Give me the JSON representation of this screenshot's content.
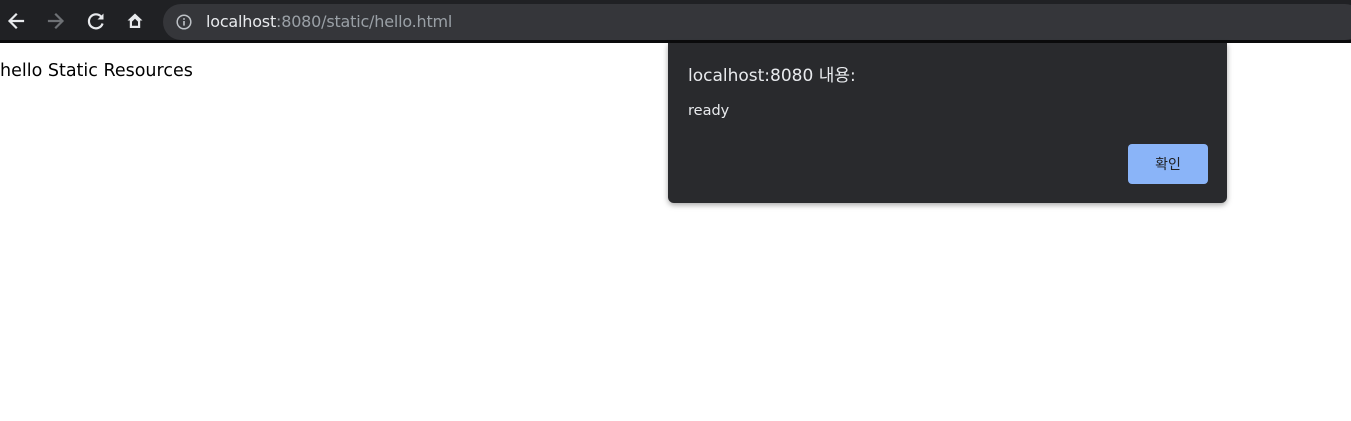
{
  "browser": {
    "back_icon": "arrow-left-icon",
    "forward_icon": "arrow-right-icon",
    "reload_icon": "reload-icon",
    "home_icon": "home-icon",
    "site_info_icon": "info-icon",
    "address": {
      "host": "localhost",
      "rest": ":8080/static/hello.html"
    },
    "colors": {
      "toolbar": "#202124",
      "omnibox": "#35363a",
      "icon_active": "#e8eaed",
      "icon_disabled": "#6e7175"
    }
  },
  "page": {
    "text": "hello Static Resources"
  },
  "alert_dialog": {
    "title": "localhost:8080 내용:",
    "message": "ready",
    "ok_label": "확인",
    "colors": {
      "background": "#292a2d",
      "button": "#8ab4f8"
    }
  }
}
